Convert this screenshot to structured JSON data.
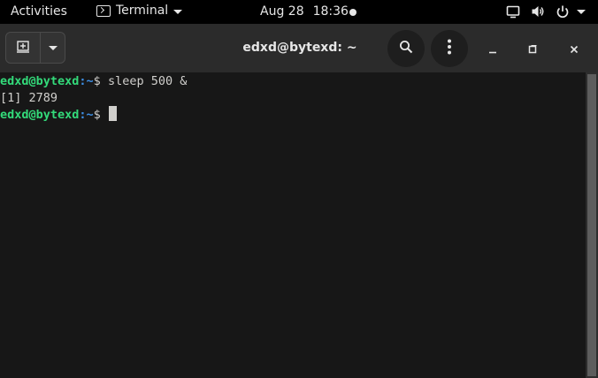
{
  "topbar": {
    "activities_label": "Activities",
    "app_name": "Terminal",
    "date": "Aug 28",
    "time": "18:36"
  },
  "window": {
    "title": "edxd@bytexd: ~"
  },
  "terminal": {
    "lines": [
      {
        "user": "edxd@bytexd",
        "path": ":~",
        "symbol": "$ ",
        "command": "sleep 500 &"
      },
      {
        "output": "[1] 2789"
      },
      {
        "user": "edxd@bytexd",
        "path": ":~",
        "symbol": "$ ",
        "command": ""
      }
    ]
  },
  "icons": {
    "terminal": "terminal-icon",
    "screen": "screen-icon",
    "volume": "volume-icon",
    "power": "power-icon",
    "new_tab": "new-tab-icon",
    "search": "search-icon",
    "menu": "kebab-menu-icon",
    "minimize": "minimize-icon",
    "maximize": "maximize-icon",
    "close": "close-icon"
  },
  "colors": {
    "prompt_user": "#33da7a",
    "prompt_path": "#3d8fe6",
    "terminal_bg": "#171717",
    "text": "#d0cfcc"
  }
}
